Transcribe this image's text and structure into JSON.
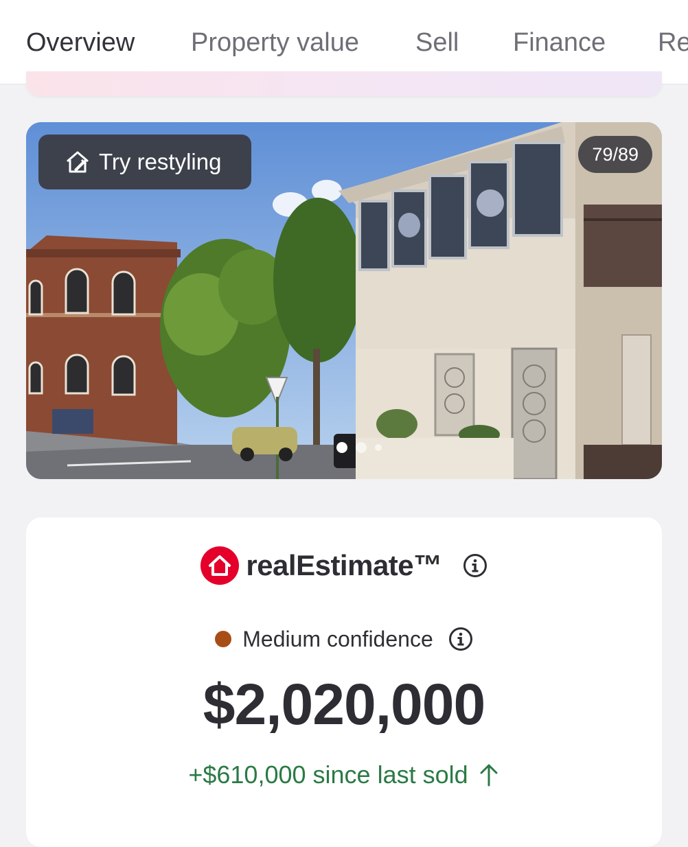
{
  "tabs": [
    {
      "label": "Overview",
      "active": true
    },
    {
      "label": "Property value",
      "active": false
    },
    {
      "label": "Sell",
      "active": false
    },
    {
      "label": "Finance",
      "active": false
    },
    {
      "label": "Re",
      "active": false
    }
  ],
  "gallery": {
    "restyle_label": "Try restyling",
    "restyle_icon": "restyle-house-icon",
    "counter": "79/89",
    "photo_description_icon": "property-photo"
  },
  "estimate": {
    "brand": "realEstimate™",
    "brand_icon": "realestate-house-logo",
    "confidence_label": "Medium confidence",
    "confidence_color": "#a94d16",
    "price": "$2,020,000",
    "change_text": "+$610,000 since last sold",
    "change_icon": "arrow-up-icon",
    "change_color": "#2a7a45"
  },
  "colors": {
    "accent": "#e4002b",
    "text_dark": "#2e2d33",
    "text_muted": "#6e6e76",
    "background": "#f2f2f5"
  }
}
